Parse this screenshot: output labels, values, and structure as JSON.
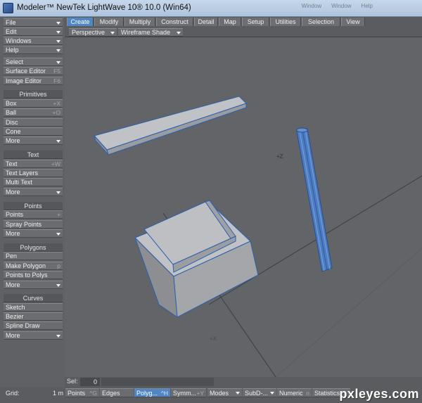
{
  "window": {
    "title": "Modeler™ NewTek LightWave 10® 10.0 (Win64)",
    "controls": [
      "Window",
      "Window",
      "Help"
    ]
  },
  "sidebar": {
    "top": [
      {
        "label": "File",
        "dropdown": true
      },
      {
        "label": "Edit",
        "dropdown": true
      },
      {
        "label": "Windows",
        "dropdown": true
      },
      {
        "label": "Help",
        "dropdown": true
      }
    ],
    "tools": [
      {
        "label": "Select",
        "dropdown": true
      },
      {
        "label": "Surface Editor",
        "shortcut": "F5"
      },
      {
        "label": "Image Editor",
        "shortcut": "F6"
      }
    ],
    "groups": [
      {
        "title": "Primitives",
        "items": [
          {
            "label": "Box",
            "shortcut": "+X"
          },
          {
            "label": "Ball",
            "shortcut": "+O"
          },
          {
            "label": "Disc",
            "shortcut": ""
          },
          {
            "label": "Cone",
            "shortcut": ""
          },
          {
            "label": "More",
            "dropdown": true
          }
        ]
      },
      {
        "title": "Text",
        "items": [
          {
            "label": "Text",
            "shortcut": "+W"
          },
          {
            "label": "Text Layers",
            "shortcut": ""
          },
          {
            "label": "Multi Text",
            "shortcut": ""
          },
          {
            "label": "More",
            "dropdown": true
          }
        ]
      },
      {
        "title": "Points",
        "items": [
          {
            "label": "Points",
            "shortcut": "+"
          },
          {
            "label": "Spray Points",
            "shortcut": ""
          },
          {
            "label": "More",
            "dropdown": true
          }
        ]
      },
      {
        "title": "Polygons",
        "items": [
          {
            "label": "Pen",
            "shortcut": ""
          },
          {
            "label": "Make Polygon",
            "shortcut": "p"
          },
          {
            "label": "Points to Polys",
            "shortcut": ""
          },
          {
            "label": "More",
            "dropdown": true
          }
        ]
      },
      {
        "title": "Curves",
        "items": [
          {
            "label": "Sketch",
            "shortcut": ""
          },
          {
            "label": "Bezier",
            "shortcut": ""
          },
          {
            "label": "Spline Draw",
            "shortcut": ""
          },
          {
            "label": "More",
            "dropdown": true
          }
        ]
      }
    ]
  },
  "tabs": [
    "Create",
    "Modify",
    "Multiply",
    "Construct",
    "Detail",
    "Map",
    "Setup",
    "Utilities",
    "Selection",
    "View"
  ],
  "active_tab": "Create",
  "viewport": {
    "view_mode": "Perspective",
    "shade_mode": "Wireframe Shade",
    "axis_labels": {
      "z": "+Z",
      "x": "+X"
    }
  },
  "status": {
    "sel_label": "Sel:",
    "sel_value": "0",
    "grid_label": "Grid:",
    "grid_value": "1 m"
  },
  "bottom_buttons": [
    {
      "label": "Points",
      "shortcut": "^G"
    },
    {
      "label": "Edges",
      "shortcut": ""
    },
    {
      "label": "Polyg...",
      "shortcut": "^H",
      "active": true
    },
    {
      "label": "Symm...",
      "shortcut": "+Y"
    },
    {
      "label": "Modes",
      "dropdown": true
    },
    {
      "label": "SubD-...",
      "dropdown": true
    },
    {
      "label": "Numeric",
      "shortcut": "n"
    },
    {
      "label": "Statistics",
      "shortcut": ""
    }
  ],
  "watermark": "pxleyes.com",
  "colors": {
    "accent": "#4f86c3",
    "panel": "#6a6c70",
    "viewport_bg": "#626467",
    "object_face": "#b3b5b8",
    "object_edge": "#2b5fb0"
  }
}
